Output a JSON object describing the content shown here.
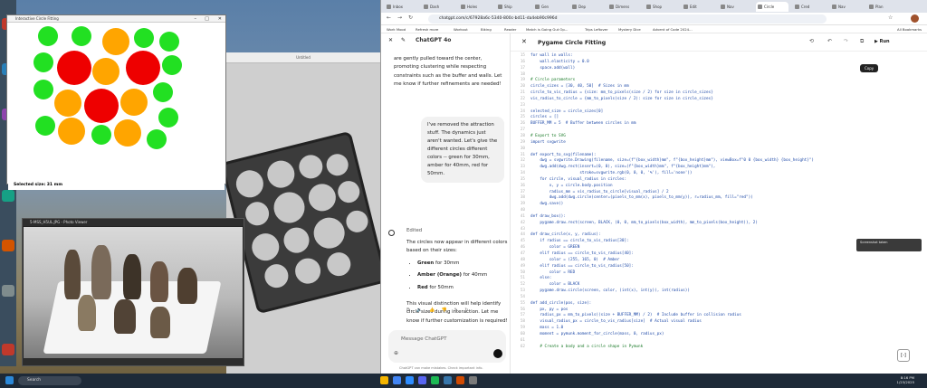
{
  "circle_window": {
    "title": "Interactive Circle Fitting",
    "selected_size": "Selected size: 31 mm",
    "colors": {
      "green": "#22e022",
      "orange": "#ffa500",
      "red": "#ee0000"
    }
  },
  "bg_app": {
    "title": "Untitled"
  },
  "photo_viewer": {
    "title": "5-MSS_H5UL.JPG - Photo Viewer"
  },
  "browser": {
    "tabs": [
      "Inbox",
      "Dash",
      "Holes",
      "Ship",
      "Gen",
      "Dep",
      "Dimens",
      "Shop",
      "Edit",
      "Nav",
      "Circle",
      "Cred",
      "Nav",
      "Plan"
    ],
    "url": "chatgpt.com/c/67928a6c-5340-800c-bd11-da4eb90c996d",
    "bookmarks": [
      "Work Mood",
      "Refresh more",
      "Workout",
      "Biking",
      "Reader",
      "Match is Going Gut Op...",
      "Trips Leftover",
      "Mystery Dice",
      "Advent of Code 2024...",
      "All Bookmarks"
    ]
  },
  "chat": {
    "model": "ChatGPT 4o",
    "prev_text": "are gently pulled toward the center, promoting clustering while respecting constraints such as the buffer and walls. Let me know if further refinements are needed!",
    "user_msg": "I've removed the attraction stuff. The dynamics just aren't wanted. Let's give the different circles different colors -- green for 30mm, amber for 40mm, red for 50mm.",
    "edited": "Edited",
    "answer_intro": "The circles now appear in different colors based on their sizes:",
    "bullets": [
      {
        "b": "Green",
        "t": " for 30mm"
      },
      {
        "b": "Amber (Orange)",
        "t": " for 40mm"
      },
      {
        "b": "Red",
        "t": " for 50mm"
      }
    ],
    "answer_outro": "This visual distinction will help identify circle sizes during interaction. Let me know if further customization is required!",
    "placeholder": "Message ChatGPT",
    "disclaimer": "ChatGPT can make mistakes. Check important info."
  },
  "canvas": {
    "title": "Pygame Circle Fitting",
    "run": "Run",
    "tooltip": "Copy",
    "lines": [
      {
        "n": "15",
        "t": "for wall in walls:"
      },
      {
        "n": "16",
        "t": "    wall.elasticity = 0.0"
      },
      {
        "n": "17",
        "t": "    space.add(wall)"
      },
      {
        "n": "18",
        "t": ""
      },
      {
        "n": "19",
        "t": "# Circle parameters",
        "c": true
      },
      {
        "n": "20",
        "t": "circle_sizes = [30, 40, 50]  # Sizes in mm"
      },
      {
        "n": "21",
        "t": "circle_to_vis_radius = {size: mm_to_pixels(size / 2) for size in circle_sizes}"
      },
      {
        "n": "22",
        "t": "vis_radius_to_circle = {mm_to_pixels(size / 2): size for size in circle_sizes}"
      },
      {
        "n": "23",
        "t": ""
      },
      {
        "n": "24",
        "t": "selected_size = circle_sizes[0]"
      },
      {
        "n": "25",
        "t": "circles = []"
      },
      {
        "n": "26",
        "t": "BUFFER_MM = 5  # Buffer between circles in mm"
      },
      {
        "n": "27",
        "t": ""
      },
      {
        "n": "28",
        "t": "# Export to SVG",
        "c": true
      },
      {
        "n": "29",
        "t": "import svgwrite"
      },
      {
        "n": "30",
        "t": ""
      },
      {
        "n": "31",
        "t": "def export_to_svg(filename):"
      },
      {
        "n": "32",
        "t": "    dwg = svgwrite.Drawing(filename, size=(f\"{box_width}mm\", f\"{box_height}mm\"), viewBox=f\"0 0 {box_width} {box_height}\")"
      },
      {
        "n": "33",
        "t": "    dwg.add(dwg.rect(insert=(0, 0), size=(f\"{box_width}mm\", f\"{box_height}mm\"),"
      },
      {
        "n": "34",
        "t": "                     stroke=svgwrite.rgb(0, 0, 0, '%'), fill='none'))"
      },
      {
        "n": "35",
        "t": "    for circle, visual_radius in circles:"
      },
      {
        "n": "36",
        "t": "        x, y = circle.body.position"
      },
      {
        "n": "37",
        "t": "        radius_mm = vis_radius_to_circle[visual_radius] / 2"
      },
      {
        "n": "38",
        "t": "        dwg.add(dwg.circle(center=(pixels_to_mm(x), pixels_to_mm(y)), r=radius_mm, fill=\"red\"))"
      },
      {
        "n": "39",
        "t": "    dwg.save()"
      },
      {
        "n": "40",
        "t": ""
      },
      {
        "n": "41",
        "t": "def draw_box():"
      },
      {
        "n": "42",
        "t": "    pygame.draw.rect(screen, BLACK, (0, 0, mm_to_pixels(box_width), mm_to_pixels(box_height)), 2)"
      },
      {
        "n": "43",
        "t": ""
      },
      {
        "n": "44",
        "t": "def draw_circle(x, y, radius):"
      },
      {
        "n": "45",
        "t": "    if radius == circle_to_vis_radius[30]:"
      },
      {
        "n": "46",
        "t": "        color = GREEN"
      },
      {
        "n": "47",
        "t": "    elif radius == circle_to_vis_radius[40]:"
      },
      {
        "n": "48",
        "t": "        color = (255, 165, 0)  # Amber"
      },
      {
        "n": "49",
        "t": "    elif radius == circle_to_vis_radius[50]:"
      },
      {
        "n": "50",
        "t": "        color = RED"
      },
      {
        "n": "51",
        "t": "    else:"
      },
      {
        "n": "52",
        "t": "        color = BLACK"
      },
      {
        "n": "53",
        "t": "    pygame.draw.circle(screen, color, (int(x), int(y)), int(radius))"
      },
      {
        "n": "54",
        "t": ""
      },
      {
        "n": "55",
        "t": "def add_circle(pos, size):"
      },
      {
        "n": "56",
        "t": "    px, py = pos"
      },
      {
        "n": "57",
        "t": "    radius_px = mm_to_pixels((size + BUFFER_MM) / 2)  # Include buffer in collision radius"
      },
      {
        "n": "58",
        "t": "    visual_radius_px = circle_to_vis_radius[size]  # Actual visual radius"
      },
      {
        "n": "59",
        "t": "    mass = 1.0"
      },
      {
        "n": "60",
        "t": "    moment = pymunk.moment_for_circle(mass, 0, radius_px)"
      },
      {
        "n": "61",
        "t": ""
      },
      {
        "n": "62",
        "t": "    # Create a body and a circle shape in Pymunk",
        "c": true
      }
    ]
  },
  "notification": "Screenshot taken",
  "taskbar": {
    "search": "Search",
    "time": "8:16 PM",
    "date": "1/23/2025"
  }
}
